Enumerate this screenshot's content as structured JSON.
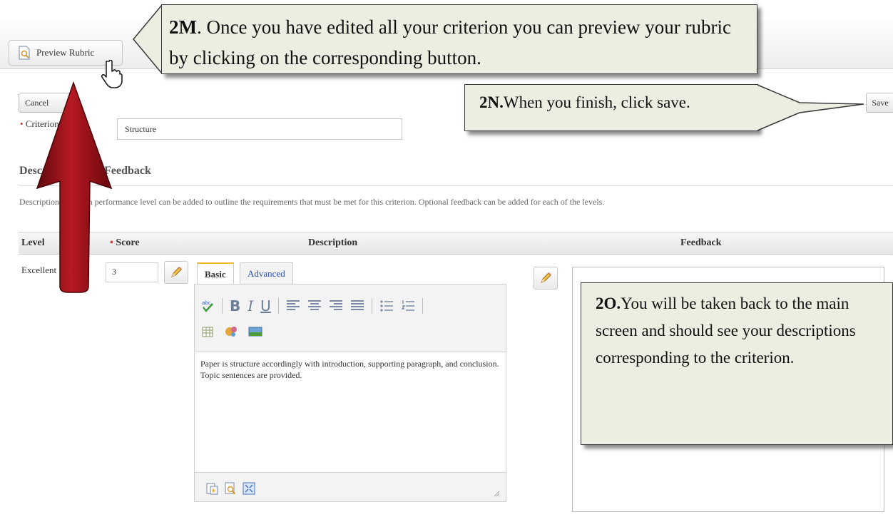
{
  "toolbar": {
    "preview_label": "Preview Rubric"
  },
  "form": {
    "cancel_label": "Cancel",
    "save_label": "Save",
    "criterion_label": "Criterion Name:",
    "criterion_value": "Structure",
    "section_title": "Descriptions and Feedback",
    "help_text": "Descriptions for each performance level can be added to outline the requirements that must be met for this criterion. Optional feedback can be added for each of the levels."
  },
  "table": {
    "headers": {
      "level": "Level",
      "score": "Score",
      "description": "Description",
      "feedback": "Feedback"
    },
    "row": {
      "level": "Excellent",
      "score": "3",
      "tab_basic": "Basic",
      "tab_advanced": "Advanced",
      "description": "Paper is structure accordingly with introduction, supporting paragraph, and conclusion.  Topic sentences are provided.",
      "feedback": ""
    }
  },
  "callouts": {
    "c2m_tag": "2M",
    "c2m_text": ". Once you have edited all your criterion you can preview your rubric by clicking on the corresponding button.",
    "c2n_tag": "2N.",
    "c2n_text": "When you finish, click save.",
    "c2o_tag": "2O.",
    "c2o_text": "You will be taken back to the main screen and should see your descriptions corresponding to the criterion."
  },
  "colors": {
    "arrow": "#9b0f16",
    "callout_bg": "#eeede2",
    "required": "#d2322d"
  },
  "icons": [
    "preview-doc-icon",
    "hand-cursor-icon",
    "pencil-icon",
    "spellcheck-icon",
    "bold-icon",
    "italic-icon",
    "underline-icon",
    "align-left-icon",
    "align-center-icon",
    "align-right-icon",
    "justify-icon",
    "bullet-list-icon",
    "numbered-list-icon",
    "table-icon",
    "image-icon",
    "paste-icon",
    "preview-icon",
    "fullscreen-icon",
    "resize-grip-icon",
    "red-up-arrow"
  ]
}
